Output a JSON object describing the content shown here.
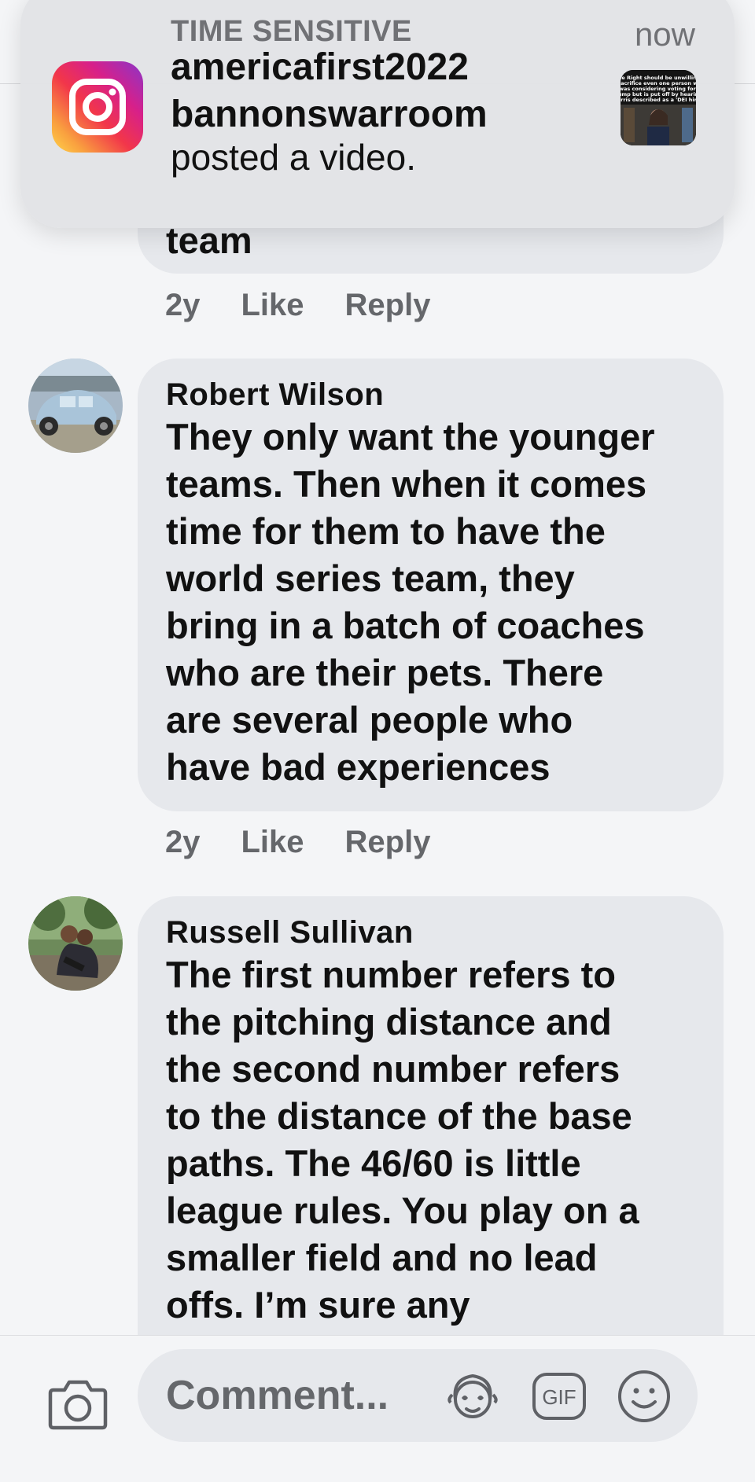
{
  "notification": {
    "label": "TIME SENSITIVE",
    "time": "now",
    "title": "americafirst2022\nbannonswarroom",
    "body": "posted a video.",
    "app_icon": "instagram-icon",
    "thumbnail_text": "The Right should be unwilling to sacrifice even one person who was considering voting for Trump but is put off by hearing Harris described as a 'DEI hire.'"
  },
  "comments": [
    {
      "partial_text": "team",
      "age": "2y",
      "like_label": "Like",
      "reply_label": "Reply"
    },
    {
      "author": "Robert Wilson",
      "text": "They only want the younger\nteams. Then when it comes\ntime for them to have the\nworld series team, they\nbring in a batch of coaches\nwho are their pets. There\nare several people who\nhave bad experiences",
      "age": "2y",
      "like_label": "Like",
      "reply_label": "Reply"
    },
    {
      "author": "Russell Sullivan",
      "text": "The first number refers to\nthe pitching distance and\nthe second number refers\nto the distance of the base\npaths.  The 46/60 is little\nleague rules.  You play on a\nsmaller field and no lead\noffs.  I’m sure any"
    }
  ],
  "composer": {
    "placeholder": "Comment...",
    "camera_icon": "camera-icon",
    "avatar_icon": "avatar-sticker-icon",
    "gif_label": "GIF",
    "emoji_icon": "emoji-icon"
  },
  "colors": {
    "background": "#f4f5f7",
    "bubble": "#e6e8ec",
    "meta_text": "#65676b"
  }
}
